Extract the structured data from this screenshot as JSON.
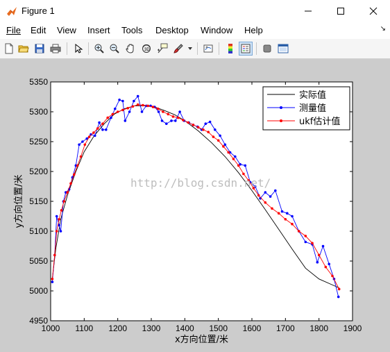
{
  "window": {
    "title": "Figure 1"
  },
  "menu": [
    "File",
    "Edit",
    "View",
    "Insert",
    "Tools",
    "Desktop",
    "Window",
    "Help"
  ],
  "menu_dock_glyph": "↘",
  "toolbar": {
    "buttons": [
      "new-figure",
      "open-file",
      "save-figure",
      "print-figure",
      "edit-plot",
      "zoom-in",
      "zoom-out",
      "pan",
      "rotate-3d",
      "data-cursor",
      "brush",
      "link-plot",
      "insert-colorbar",
      "insert-legend",
      "hide-plot-tools",
      "show-plot-tools"
    ]
  },
  "colors": {
    "actual": "#000000",
    "measured": "#0000ff",
    "ukf": "#ff0000",
    "figure_bg": "#cccccc"
  },
  "watermark": "http://blog.csdn.net/",
  "chart_data": {
    "type": "line",
    "xlabel": "x方向位置/米",
    "ylabel": "y方向位置/米",
    "xlim": [
      1000,
      1900
    ],
    "ylim": [
      4950,
      5350
    ],
    "xticks": [
      1000,
      1100,
      1200,
      1300,
      1400,
      1500,
      1600,
      1700,
      1800,
      1900
    ],
    "yticks": [
      4950,
      5000,
      5050,
      5100,
      5150,
      5200,
      5250,
      5300,
      5350
    ],
    "legend_position": "top-right",
    "series": [
      {
        "name": "实际值",
        "color": "#000000",
        "marker": "none",
        "x": [
          1005,
          1015,
          1030,
          1050,
          1075,
          1100,
          1130,
          1160,
          1190,
          1220,
          1250,
          1280,
          1310,
          1340,
          1370,
          1400,
          1440,
          1480,
          1520,
          1560,
          1600,
          1640,
          1680,
          1720,
          1760,
          1800,
          1840,
          1860
        ],
        "y": [
          5020,
          5070,
          5120,
          5160,
          5200,
          5233,
          5260,
          5280,
          5296,
          5305,
          5310,
          5310,
          5308,
          5302,
          5295,
          5285,
          5268,
          5248,
          5225,
          5198,
          5168,
          5136,
          5103,
          5070,
          5038,
          5020,
          5010,
          5005
        ]
      },
      {
        "name": "测量值",
        "color": "#0000ff",
        "marker": "dot",
        "x": [
          1005,
          1012,
          1018,
          1025,
          1030,
          1038,
          1045,
          1055,
          1065,
          1075,
          1085,
          1095,
          1108,
          1120,
          1132,
          1145,
          1155,
          1165,
          1180,
          1192,
          1205,
          1215,
          1222,
          1235,
          1248,
          1260,
          1272,
          1285,
          1298,
          1310,
          1322,
          1332,
          1345,
          1360,
          1372,
          1385,
          1398,
          1412,
          1425,
          1438,
          1450,
          1462,
          1475,
          1490,
          1505,
          1520,
          1535,
          1550,
          1565,
          1580,
          1595,
          1610,
          1625,
          1640,
          1655,
          1670,
          1690,
          1705,
          1720,
          1740,
          1760,
          1780,
          1795,
          1812,
          1830,
          1845,
          1858
        ],
        "y": [
          5015,
          5060,
          5125,
          5110,
          5100,
          5150,
          5165,
          5170,
          5190,
          5210,
          5245,
          5250,
          5255,
          5262,
          5260,
          5282,
          5270,
          5270,
          5290,
          5305,
          5320,
          5318,
          5285,
          5300,
          5318,
          5326,
          5300,
          5310,
          5310,
          5308,
          5300,
          5285,
          5280,
          5285,
          5285,
          5300,
          5285,
          5282,
          5278,
          5275,
          5270,
          5280,
          5283,
          5270,
          5260,
          5245,
          5232,
          5225,
          5212,
          5210,
          5182,
          5175,
          5155,
          5165,
          5158,
          5168,
          5133,
          5130,
          5125,
          5100,
          5082,
          5078,
          5048,
          5075,
          5045,
          5020,
          4990
        ]
      },
      {
        "name": "ukf估计值",
        "color": "#ff0000",
        "marker": "dot",
        "x": [
          1005,
          1012,
          1018,
          1025,
          1032,
          1040,
          1050,
          1060,
          1070,
          1080,
          1090,
          1102,
          1115,
          1128,
          1140,
          1155,
          1170,
          1185,
          1200,
          1215,
          1230,
          1245,
          1260,
          1275,
          1290,
          1305,
          1320,
          1335,
          1350,
          1365,
          1380,
          1395,
          1410,
          1425,
          1440,
          1455,
          1470,
          1485,
          1500,
          1515,
          1530,
          1545,
          1560,
          1575,
          1590,
          1605,
          1620,
          1640,
          1660,
          1680,
          1700,
          1720,
          1740,
          1760,
          1780,
          1800,
          1820,
          1840,
          1860
        ],
        "y": [
          5020,
          5060,
          5100,
          5120,
          5135,
          5150,
          5165,
          5180,
          5195,
          5210,
          5225,
          5245,
          5258,
          5265,
          5272,
          5280,
          5290,
          5296,
          5300,
          5303,
          5306,
          5309,
          5312,
          5311,
          5310,
          5308,
          5305,
          5300,
          5296,
          5292,
          5290,
          5286,
          5282,
          5278,
          5274,
          5270,
          5266,
          5258,
          5252,
          5242,
          5232,
          5221,
          5210,
          5196,
          5185,
          5172,
          5160,
          5148,
          5138,
          5130,
          5120,
          5112,
          5100,
          5092,
          5080,
          5060,
          5040,
          5025,
          5003
        ]
      }
    ]
  }
}
